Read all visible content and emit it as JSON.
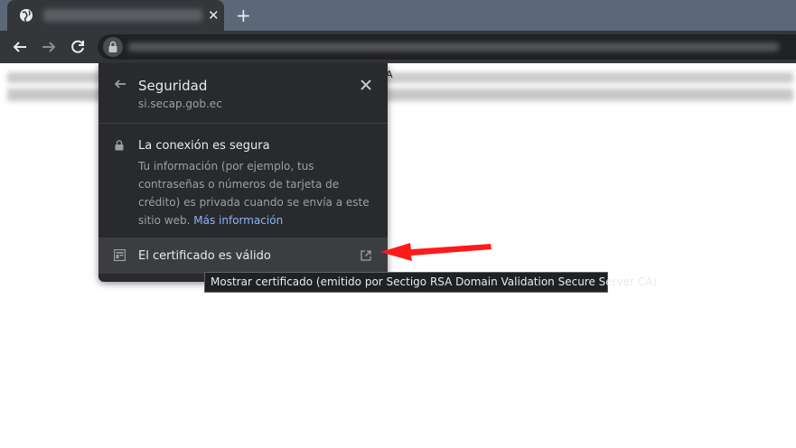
{
  "browser": {
    "tab": {
      "close_icon": "close-icon",
      "favicon": "globe-icon"
    },
    "new_tab_label": "+",
    "toolbar": {
      "back": "back-arrow-icon",
      "forward": "forward-arrow-icon",
      "reload": "reload-icon",
      "lock": "lock-icon"
    }
  },
  "page": {
    "visible_char": "A"
  },
  "site_info": {
    "title": "Seguridad",
    "domain": "si.secap.gob.ec",
    "connection_title": "La conexión es segura",
    "connection_description": "Tu información (por ejemplo, tus contraseñas o números de tarjeta de crédito) es privada cuando se envía a este sitio web.",
    "more_info_link": "Más información",
    "certificate_label": "El certificado es válido"
  },
  "tooltip": {
    "text": "Mostrar certificado (emitido por Sectigo RSA Domain Validation Secure Server CA)"
  },
  "colors": {
    "tabstrip": "#5c6878",
    "toolbar": "#35363a",
    "popup": "#292a2d",
    "link": "#8ab4f8",
    "arrow": "#ff0000"
  }
}
